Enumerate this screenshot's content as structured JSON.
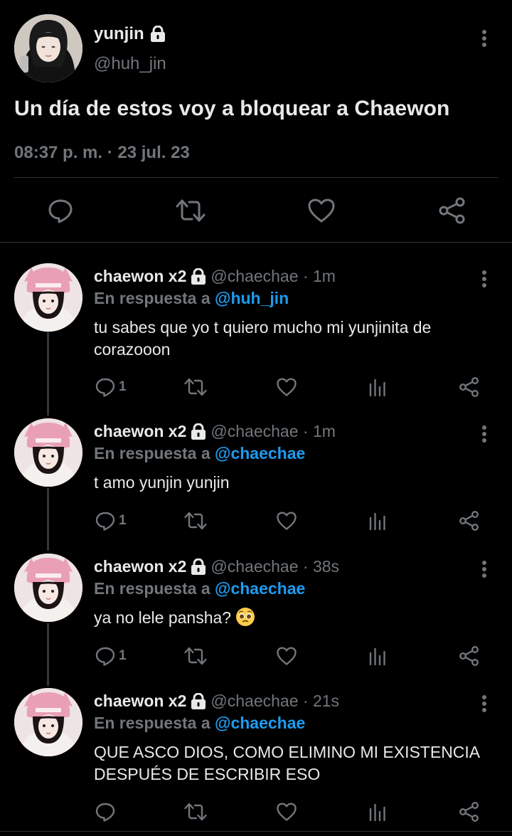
{
  "main": {
    "name": "yunjin",
    "handle": "@huh_jin",
    "text": "Un día de estos voy a bloquear a Chaewon",
    "meta": "08:37 p. m. · 23 jul. 23",
    "icons": [
      "more-icon",
      "reply-icon",
      "retweet-icon",
      "like-icon",
      "share-icon"
    ]
  },
  "replies": [
    {
      "name": "chaewon x2",
      "handle": "@chaechae",
      "sep": " · ",
      "time": "1m",
      "in_reply_prefix": "En respuesta a ",
      "in_reply_handle": "@huh_jin",
      "text": "tu sabes que yo t quiero mucho mi yunjinita de corazooon",
      "reply_count": "1"
    },
    {
      "name": "chaewon x2",
      "handle": "@chaechae",
      "sep": " · ",
      "time": "1m",
      "in_reply_prefix": "En respuesta a ",
      "in_reply_handle": "@chaechae",
      "text": "t amo yunjin yunjin",
      "reply_count": "1"
    },
    {
      "name": "chaewon x2",
      "handle": "@chaechae",
      "sep": " · ",
      "time": "38s",
      "in_reply_prefix": "En respuesta a ",
      "in_reply_handle": "@chaechae",
      "text": "ya no lele pansha?",
      "emoji": "pleading-face-emoji",
      "reply_count": "1"
    },
    {
      "name": "chaewon x2",
      "handle": "@chaechae",
      "sep": " · ",
      "time": "21s",
      "in_reply_prefix": "En respuesta a ",
      "in_reply_handle": "@chaechae",
      "text": "QUE ASCO DIOS, COMO ELIMINO MI EXISTENCIA DESPUÉS DE ESCRIBIR ESO",
      "reply_count": ""
    }
  ],
  "colors": {
    "background": "#000000",
    "text": "#e7e9ea",
    "muted": "#71767b",
    "link": "#1d9bf0",
    "divider": "#2f3336"
  }
}
